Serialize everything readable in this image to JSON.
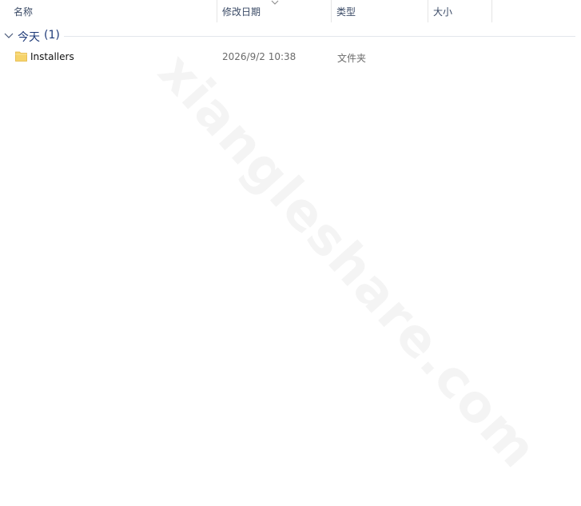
{
  "columns": {
    "name": "名称",
    "date_modified": "修改日期",
    "type": "类型",
    "size": "大小"
  },
  "group": {
    "title": "今天",
    "count": "(1)"
  },
  "rows": [
    {
      "name": "Installers",
      "date_modified": "2026/9/2 10:38",
      "type": "文件夹",
      "size": "",
      "icon": "folder-icon"
    }
  ],
  "watermark": "xiangleshare.com",
  "colors": {
    "header_text": "#3a4a66",
    "group_text": "#1e3a78",
    "folder": "#f6d36a",
    "divider": "#e5e5e5"
  }
}
